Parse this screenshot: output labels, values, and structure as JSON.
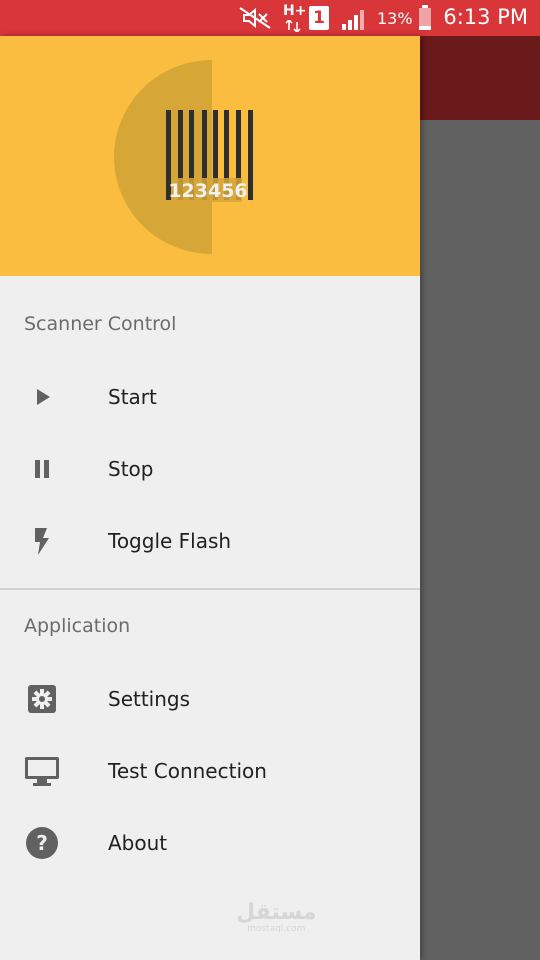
{
  "status_bar": {
    "time": "6:13 PM",
    "battery_percent": "13%",
    "network_type": "H+",
    "sim_slot": "1",
    "icons": [
      "mute-icon",
      "data-arrows-icon",
      "sim-icon",
      "signal-icon",
      "battery-icon"
    ],
    "color": "#d9363a"
  },
  "drawer": {
    "header": {
      "logo_digits": "123456",
      "background": "#fbbd3f"
    },
    "sections": [
      {
        "title": "Scanner Control",
        "items": [
          {
            "label": "Start",
            "icon": "play-icon"
          },
          {
            "label": "Stop",
            "icon": "pause-icon"
          },
          {
            "label": "Toggle Flash",
            "icon": "flash-icon"
          }
        ]
      },
      {
        "title": "Application",
        "items": [
          {
            "label": "Settings",
            "icon": "settings-icon"
          },
          {
            "label": "Test Connection",
            "icon": "monitor-icon"
          },
          {
            "label": "About",
            "icon": "help-icon"
          }
        ]
      }
    ]
  },
  "watermark": {
    "text": "مستقل",
    "subtext": "mostaql.com"
  },
  "colors": {
    "scrim": "#616161",
    "toolbar_behind": "#6a1a1a",
    "drawer_bg": "#efefef",
    "icon_gray": "#616161"
  }
}
